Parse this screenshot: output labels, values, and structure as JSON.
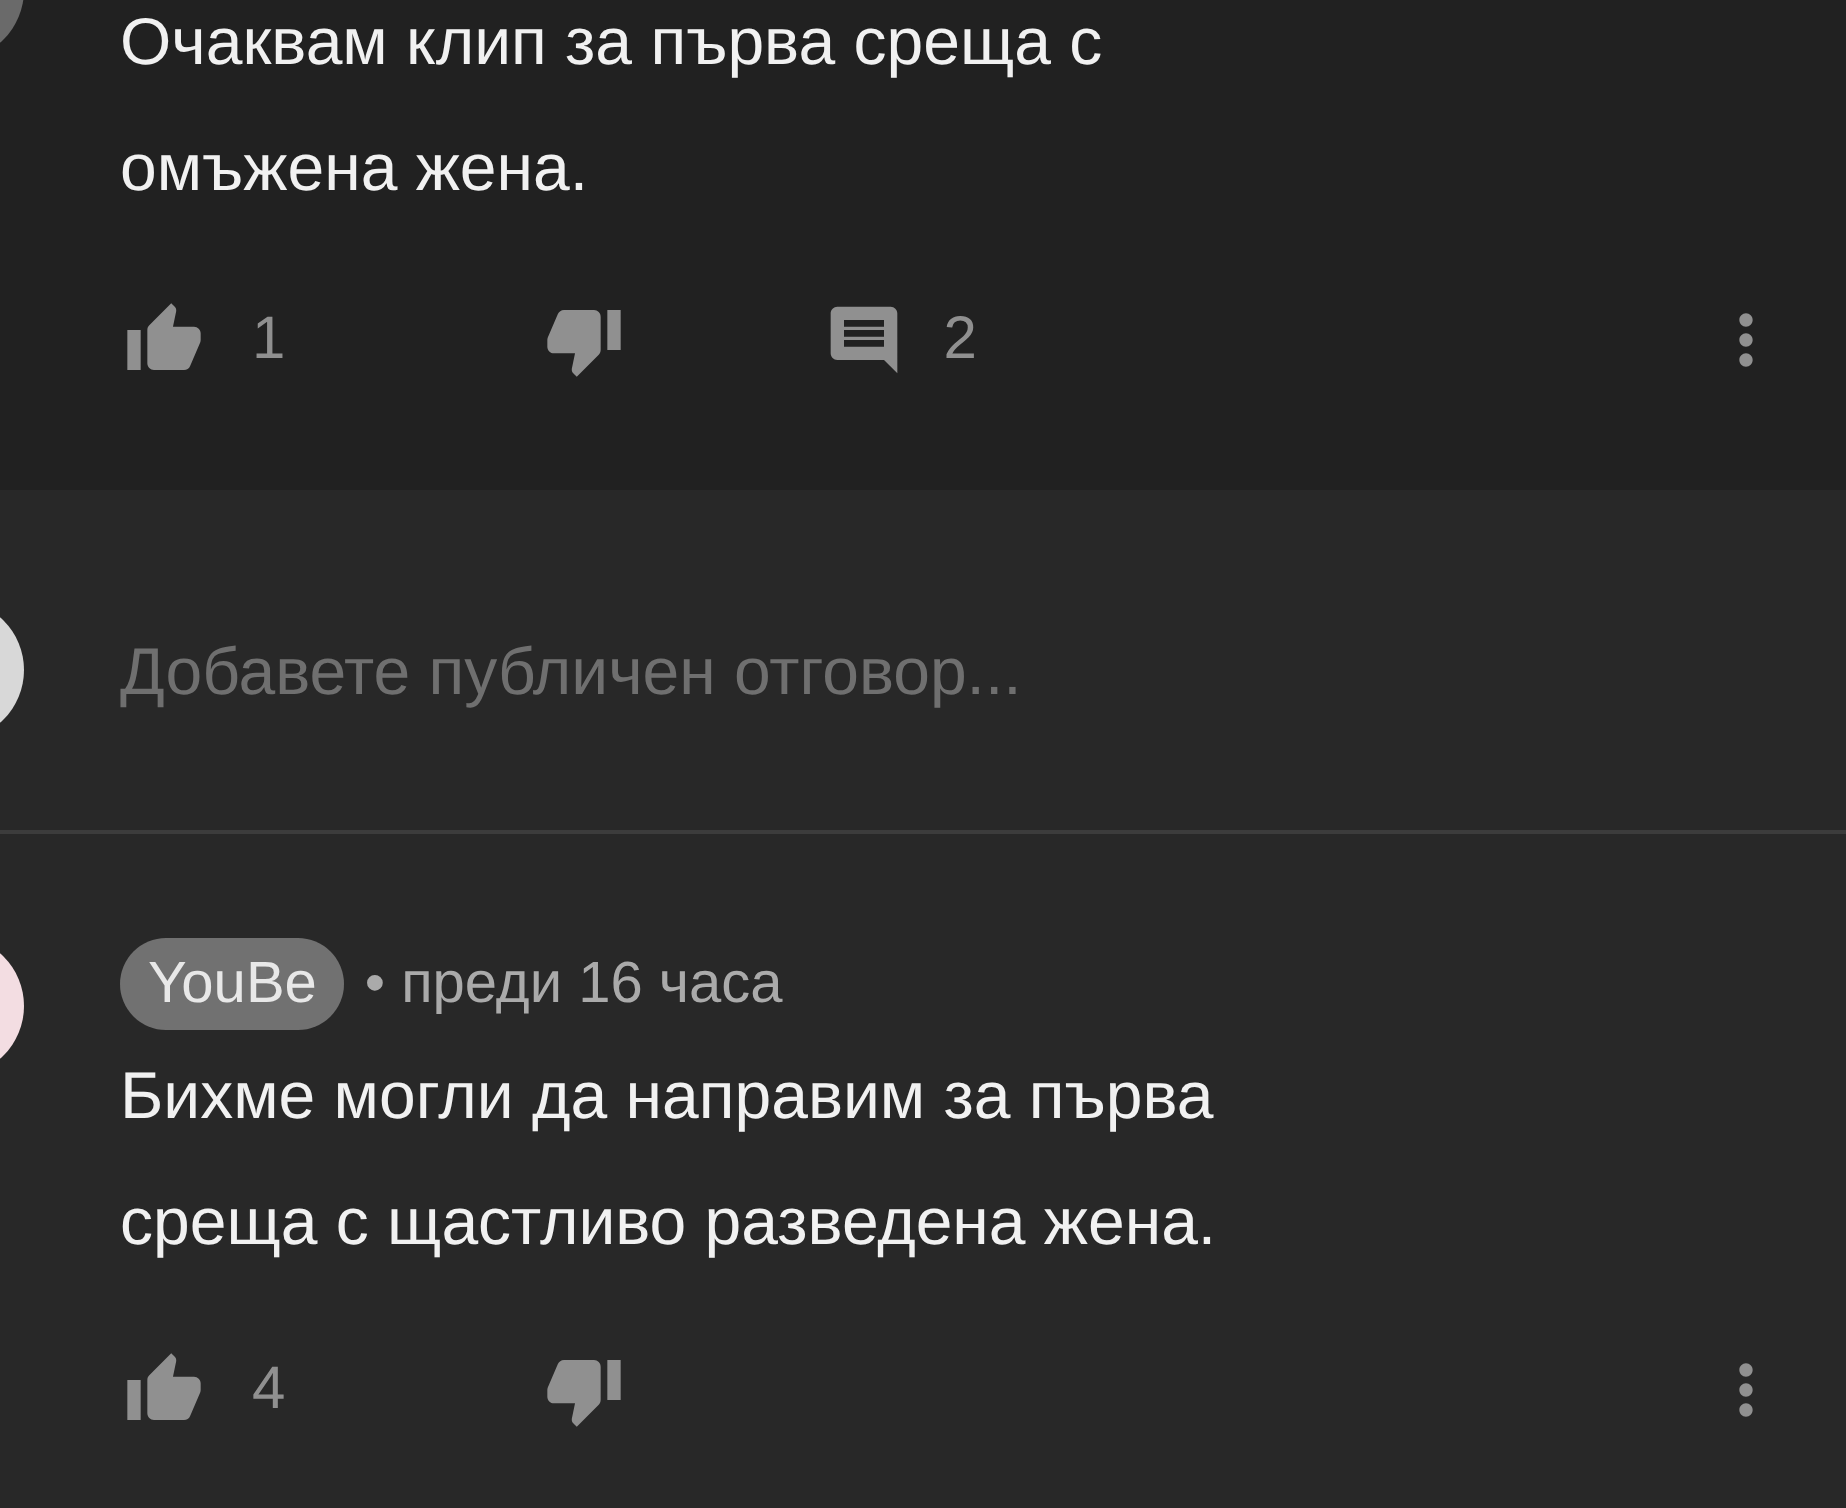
{
  "top_comment": {
    "text": "Очаквам клип за първа среща с\nомъжена жена.",
    "likes": "1",
    "replies": "2"
  },
  "reply_box": {
    "placeholder": "Добавете публичен отговор..."
  },
  "next_comment": {
    "author": "YouBe",
    "separator": "•",
    "time": "преди 16 часа",
    "text": "Бихме могли да направим за първа\nсреща с щастливо разведена жена.",
    "likes": "4"
  }
}
